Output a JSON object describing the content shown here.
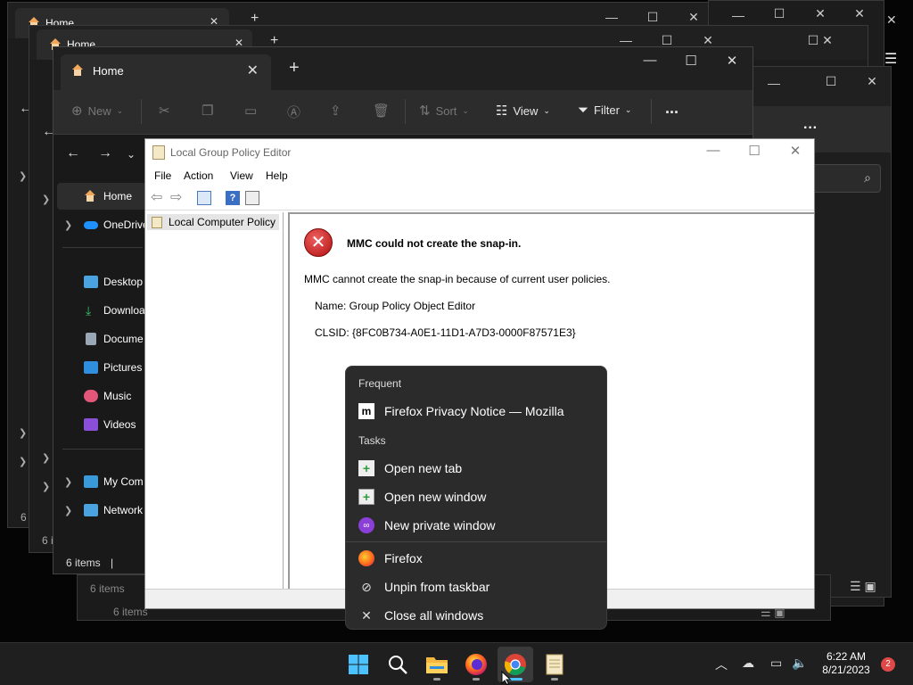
{
  "explorer_back_windows": {
    "tab_title": "Home",
    "status_1": "6 i",
    "status_2": "6 i",
    "status_3": "6 items",
    "status_4": "6 items"
  },
  "explorer": {
    "tab_title": "Home",
    "toolbar": {
      "new_label": "New",
      "sort_label": "Sort",
      "view_label": "View",
      "filter_label": "Filter",
      "more_label": "..."
    },
    "sidebar": [
      {
        "label": "Home",
        "icon": "home-icon",
        "chevron": false
      },
      {
        "label": "OneDrive",
        "icon": "cloud-icon",
        "chevron": true
      },
      {
        "label": "Desktop",
        "icon": "desktop-icon",
        "chevron": false
      },
      {
        "label": "Downloa",
        "icon": "download-icon",
        "chevron": false
      },
      {
        "label": "Docume",
        "icon": "document-icon",
        "chevron": false
      },
      {
        "label": "Pictures",
        "icon": "pictures-icon",
        "chevron": false
      },
      {
        "label": "Music",
        "icon": "music-icon",
        "chevron": false
      },
      {
        "label": "Videos",
        "icon": "videos-icon",
        "chevron": false
      },
      {
        "label": "My Com",
        "icon": "computer-icon",
        "chevron": true
      },
      {
        "label": "Network",
        "icon": "network-icon",
        "chevron": true
      }
    ],
    "status_text": "6 items",
    "status_sep": "|"
  },
  "gpedit": {
    "title": "Local Group Policy Editor",
    "menu": [
      "File",
      "Action",
      "View",
      "Help"
    ],
    "tree_root": "Local Computer Policy",
    "error_title": "MMC could not create the snap-in.",
    "error_message": "MMC cannot create the snap-in because of current user policies.",
    "name_line": "Name: Group Policy Object Editor",
    "clsid_line": "CLSID: {8FC0B734-A0E1-11D1-A7D3-0000F87571E3}"
  },
  "jumplist": {
    "frequent_header": "Frequent",
    "frequent_items": [
      {
        "label": "Firefox Privacy Notice — Mozilla",
        "icon": "mozilla-icon"
      }
    ],
    "tasks_header": "Tasks",
    "task_items": [
      {
        "label": "Open new tab",
        "icon": "new-tab-icon"
      },
      {
        "label": "Open new window",
        "icon": "new-window-icon"
      },
      {
        "label": "New private window",
        "icon": "private-window-icon"
      }
    ],
    "app_items": [
      {
        "label": "Firefox",
        "icon": "firefox-icon"
      },
      {
        "label": "Unpin from taskbar",
        "icon": "unpin-icon"
      },
      {
        "label": "Close all windows",
        "icon": "close-icon"
      }
    ]
  },
  "taskbar": {
    "apps": [
      "start-icon",
      "search-icon",
      "file-explorer-icon",
      "firefox-icon",
      "chrome-icon",
      "notepad-icon"
    ],
    "time": "6:22 AM",
    "date": "8/21/2023",
    "notification_count": "2"
  },
  "colors": {
    "desktop_bg": "#050505",
    "dark_window": "#1c1c1c",
    "jumplist_bg": "#2b2b2b",
    "error_red": "#c62828",
    "taskbar_accent": "#4cc2ff"
  }
}
